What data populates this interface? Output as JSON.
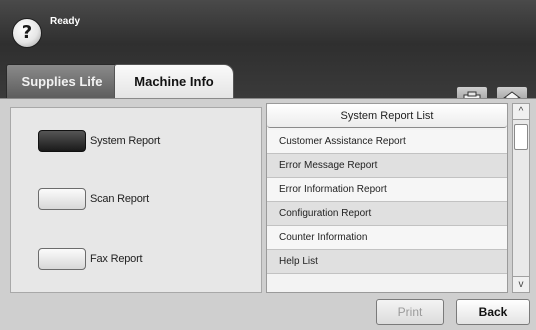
{
  "header": {
    "status": "Ready",
    "help_label": "?"
  },
  "tabs": [
    {
      "label": "Supplies Life",
      "active": false
    },
    {
      "label": "Machine Info",
      "active": true
    }
  ],
  "toolbar": {
    "counter_icon": "counter-icon",
    "home_icon": "home-icon"
  },
  "reports": [
    {
      "label": "System Report",
      "selected": true
    },
    {
      "label": "Scan Report",
      "selected": false
    },
    {
      "label": "Fax Report",
      "selected": false
    }
  ],
  "list": {
    "title": "System Report List",
    "items": [
      "Customer Assistance Report",
      "Error Message Report",
      "Error Information Report",
      "Configuration Report",
      "Counter Information",
      "Help List"
    ]
  },
  "scroll": {
    "up": "^",
    "down": "v"
  },
  "footer": {
    "print_label": "Print",
    "back_label": "Back"
  },
  "colors": {
    "header_dark": "#3a3a3a",
    "selected_toggle": "#1a1a1a",
    "disabled_text": "#9a9a9a"
  }
}
